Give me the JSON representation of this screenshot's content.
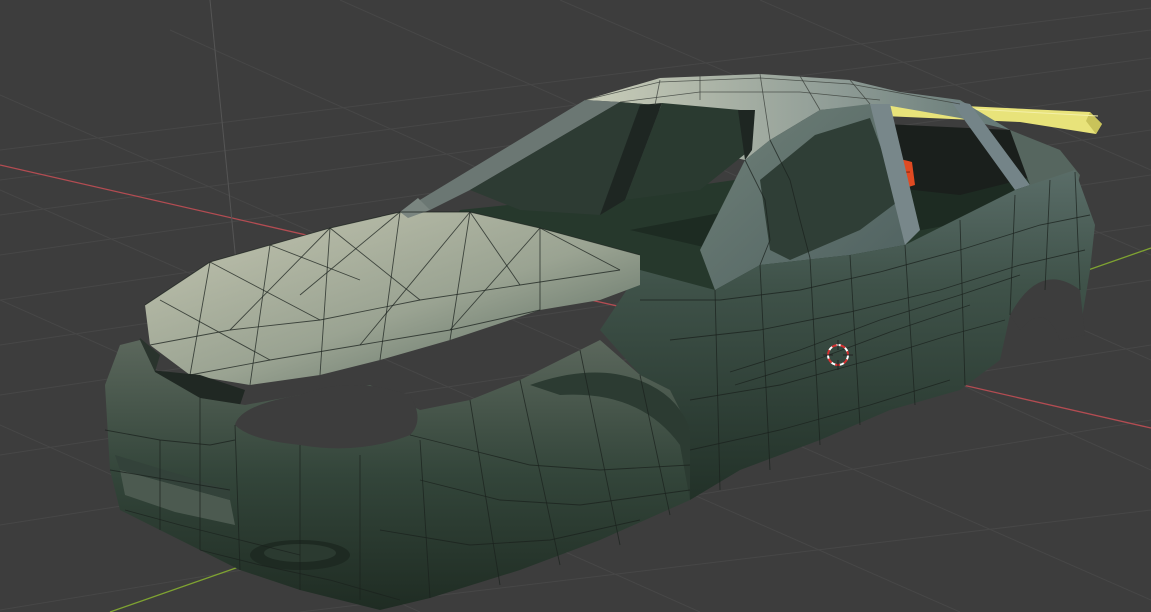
{
  "viewport": {
    "background_color": "#3d3d3d",
    "grid_color": "#474747",
    "x_axis_color": "#b34c52",
    "y_axis_color": "#7fa331",
    "z_axis_color": "#4d4d4d",
    "body_dark_color": "#26352b",
    "body_mid_color": "#5c6f67",
    "body_light_color": "#bdc1ac",
    "selected_color": "#e8e37a",
    "brake_light_color": "#e04a22",
    "cursor_color": "#d63131"
  },
  "objects": {
    "car_body": "car-body",
    "rear_spoiler": "rear-spoiler",
    "cursor": "3d-cursor"
  }
}
